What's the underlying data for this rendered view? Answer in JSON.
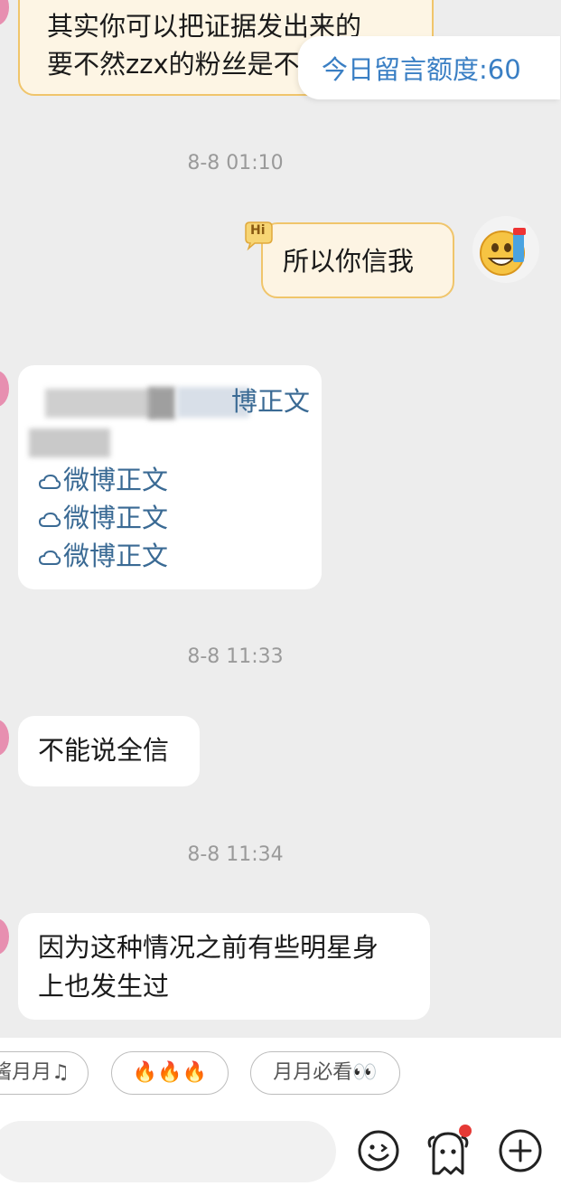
{
  "quota_badge": {
    "text": "今日留言额度:60"
  },
  "messages": {
    "top_line1": "其实你可以把证据发出来的",
    "top_line2": "要不然zzx的粉丝是不",
    "ts1": "8-8 01:10",
    "sent_text": "所以你信我",
    "hi_badge": "Hi",
    "partial_link": "博正文",
    "weibo_link_label": "微博正文",
    "ts2": "8-8 11:33",
    "reply1": "不能说全信",
    "ts3": "8-8 11:34",
    "reply2_line1": "因为这种情况之前有些明星身",
    "reply2_line2": "上也发生过"
  },
  "quick_replies": [
    "酱月月♫",
    "🔥🔥🔥",
    "月月必看👀"
  ],
  "input_bar": {
    "placeholder": ""
  },
  "colors": {
    "accent": "#3a7fc4",
    "link": "#3a6a94",
    "notification_dot": "#e53935",
    "bubble_border": "#f0c56b"
  },
  "icons": [
    "emoji-icon",
    "mascot-icon",
    "add-icon",
    "weibo-cloud-icon",
    "sticker-avatar-icon"
  ]
}
